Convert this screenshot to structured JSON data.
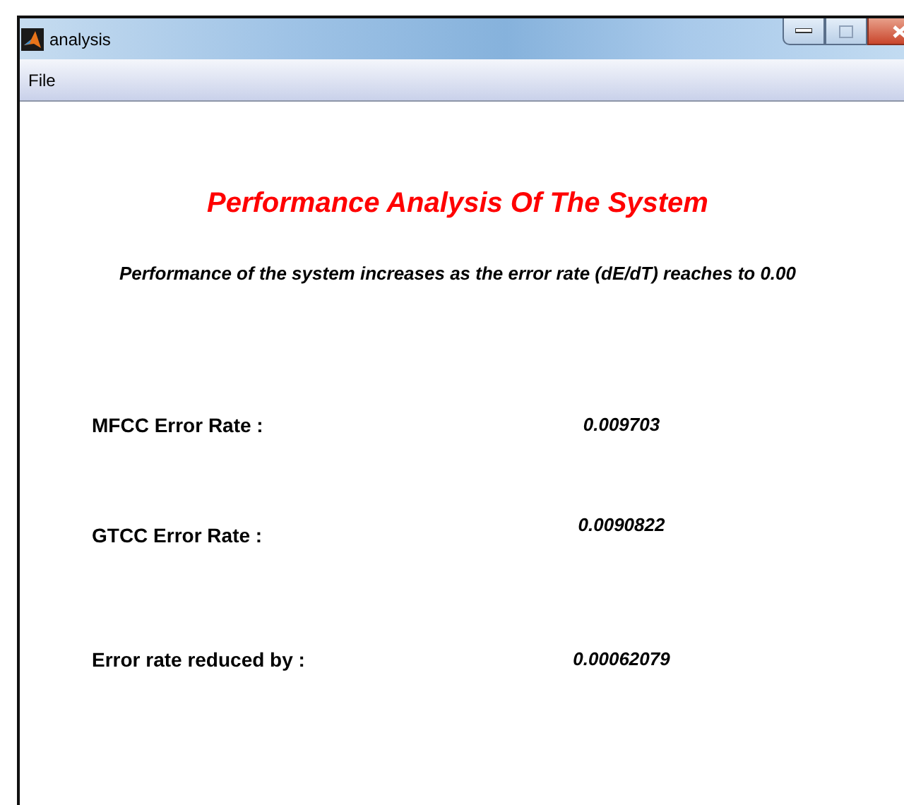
{
  "window": {
    "title": "analysis"
  },
  "menu": [
    "File"
  ],
  "heading": "Performance Analysis Of The System",
  "subtitle": "Performance of the system increases as the error rate (dE/dT) reaches to 0.00",
  "results": [
    {
      "label": "MFCC Error Rate :",
      "value": "0.009703"
    },
    {
      "label": "GTCC Error Rate :",
      "value": "0.0090822"
    },
    {
      "label": "Error rate reduced by :",
      "value": "0.00062079"
    }
  ]
}
